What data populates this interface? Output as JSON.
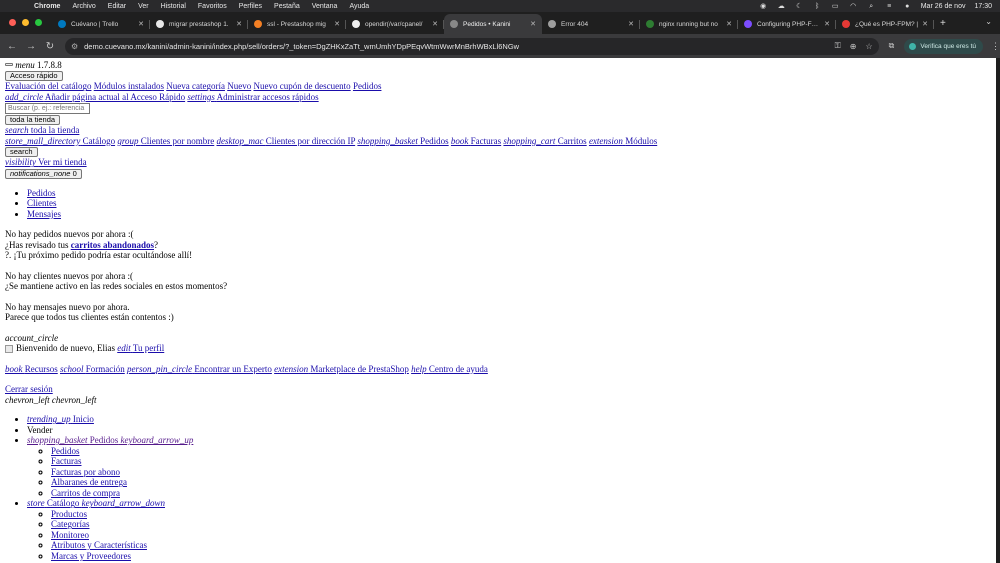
{
  "os": {
    "app_name": "Chrome",
    "menu_items": [
      "Archivo",
      "Editar",
      "Ver",
      "Historial",
      "Favoritos",
      "Perfiles",
      "Pestaña",
      "Ventana",
      "Ayuda"
    ],
    "date": "Mar 26 de nov",
    "time": "17:30"
  },
  "tabs": [
    {
      "title": "Cuévano | Trello",
      "favicon_color": "#0079bf"
    },
    {
      "title": "migrar prestashop 1.",
      "favicon_color": "#e8e8e8"
    },
    {
      "title": "ssl - Prestashop mig",
      "favicon_color": "#f48024"
    },
    {
      "title": "opendir(/var/cpanel/",
      "favicon_color": "#eeeeee"
    },
    {
      "title": "Pedidos • Kanini",
      "favicon_color": "#888888",
      "active": true
    },
    {
      "title": "Error 404",
      "favicon_color": "#9e9e9e"
    },
    {
      "title": "nginx running but no",
      "favicon_color": "#2e7d32"
    },
    {
      "title": "Configuring PHP-FPM",
      "favicon_color": "#7c4dff"
    },
    {
      "title": "¿Qué es PHP-FPM? |",
      "favicon_color": "#e53935"
    }
  ],
  "toolbar": {
    "url": "demo.cuevano.mx/kanini/admin-kanini/index.php/sell/orders/?_token=DgZHKxZaTt_wmUmhYDpPEqvWtmWwrMnBrhWBxLl6NGw",
    "verify_label": "Verifica que eres tú"
  },
  "page": {
    "menu_label": "menu",
    "version": "1.7.8.8",
    "quick_access_button": "Acceso rápido",
    "quick_links": [
      "Evaluación del catálogo",
      "Módulos instalados",
      "Nueva categoría",
      "Nuevo",
      "Nuevo cupón de descuento",
      "Pedidos"
    ],
    "add_icon": "add_circle",
    "add_quick": "Añadir página actual al Acceso Rápido",
    "settings_icon": "settings",
    "manage_quick": "Administrar accesos rápidos",
    "search_placeholder": "Buscar (p. ej.: referencia",
    "scope_button": "toda la tienda",
    "search_scopes": [
      {
        "icon": "search",
        "label": "toda la tienda"
      },
      {
        "icon": "store_mall_directory",
        "label": "Catálogo"
      },
      {
        "icon": "group",
        "label": "Clientes por nombre"
      },
      {
        "icon": "desktop_mac",
        "label": "Clientes por dirección IP"
      },
      {
        "icon": "shopping_basket",
        "label": "Pedidos"
      },
      {
        "icon": "book",
        "label": "Facturas"
      },
      {
        "icon": "shopping_cart",
        "label": "Carritos"
      },
      {
        "icon": "extension",
        "label": "Módulos"
      }
    ],
    "search_button": "search",
    "view_icon": "visibility",
    "view_store": "Ver mi tienda",
    "notif_icon": "notifications_none",
    "notif_count": "0",
    "notif_tabs": [
      "Pedidos",
      "Clientes",
      "Mensajes"
    ],
    "orders_empty": "No hay pedidos nuevos por ahora :(",
    "orders_q_prefix": "¿Has revisado tus ",
    "orders_q_link": "carritos abandonados",
    "orders_q_suffix": "?",
    "orders_hint": "?. ¡Tu próximo pedido podría estar ocultándose allí!",
    "customers_empty": "No hay clientes nuevos por ahora :(",
    "customers_hint": "¿Se mantiene activo en las redes sociales en estos momentos?",
    "messages_empty": "No hay mensajes nuevo por ahora.",
    "messages_hint": "Parece que todos tus clientes están contentos :)",
    "account_icon": "account_circle",
    "welcome": "Bienvenido de nuevo, Elias",
    "edit_icon": "edit",
    "profile_link": "Tu perfil",
    "resources": [
      {
        "icon": "book",
        "label": "Recursos"
      },
      {
        "icon": "school",
        "label": "Formación"
      },
      {
        "icon": "person_pin_circle",
        "label": "Encontrar un Experto"
      },
      {
        "icon": "extension",
        "label": "Marketplace de PrestaShop"
      },
      {
        "icon": "help",
        "label": "Centro de ayuda"
      }
    ],
    "logout": "Cerrar sesión",
    "collapse_icons": "chevron_left chevron_left",
    "nav": {
      "home_icon": "trending_up",
      "home": "Inicio",
      "sell": "Vender",
      "orders_icon": "shopping_basket",
      "orders": "Pedidos",
      "orders_arrow": "keyboard_arrow_up",
      "orders_sub": [
        "Pedidos",
        "Facturas",
        "Facturas por abono",
        "Albaranes de entrega",
        "Carritos de compra"
      ],
      "catalog_icon": "store",
      "catalog": "Catálogo",
      "catalog_arrow": "keyboard_arrow_down",
      "catalog_sub": [
        "Productos",
        "Categorías",
        "Monitoreo",
        "Atributos y Características",
        "Marcas y Proveedores"
      ]
    }
  }
}
